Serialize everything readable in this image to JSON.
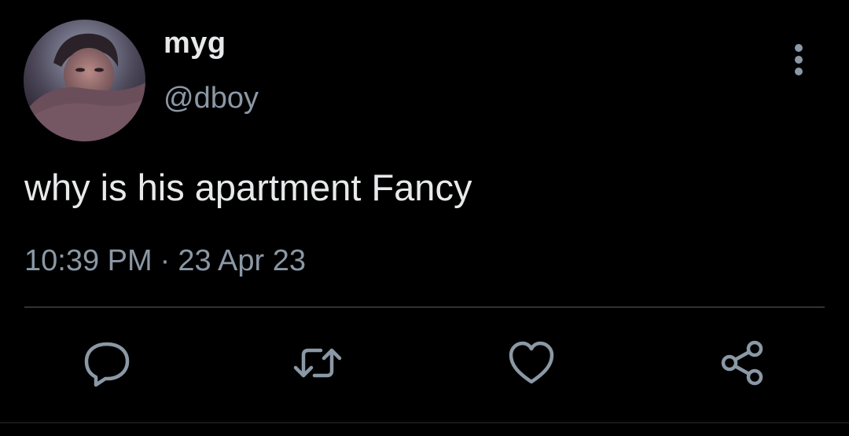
{
  "author": {
    "display_name": "myg",
    "handle": "@dboy"
  },
  "tweet": {
    "text": "why is his apartment Fancy",
    "time": "10:39 PM",
    "separator": "·",
    "date": "23 Apr 23"
  },
  "actions": [
    {
      "icon": "reply-icon"
    },
    {
      "icon": "retweet-icon"
    },
    {
      "icon": "like-icon"
    },
    {
      "icon": "share-icon"
    }
  ],
  "colors": {
    "background": "#000000",
    "primary_text": "#e7e9ea",
    "secondary_text": "#8b98a5",
    "divider": "#2f3336"
  }
}
